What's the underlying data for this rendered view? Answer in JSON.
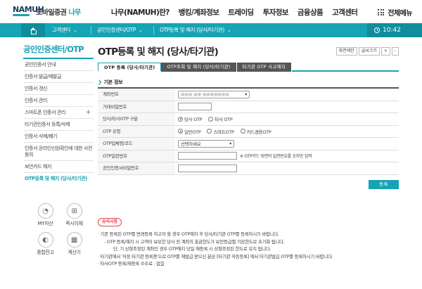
{
  "header": {
    "logo_mark": "NAMUH",
    "logo_title": "모바일증권",
    "logo_tag": "나무",
    "gnb": [
      "나무(NAMUH)란?",
      "뱅킹/계좌정보",
      "트레이딩",
      "투자정보",
      "금융상품",
      "고객센터"
    ],
    "all_menu": "전체메뉴"
  },
  "breadcrumb": {
    "items": [
      "고객센터",
      "공인인증센터/OTP",
      "OTP등록 및 해지 (당사/타기관)"
    ],
    "time": "10:42"
  },
  "sidebar": {
    "title": "공인인증센터/OTP",
    "items": [
      {
        "label": "공인인증서 안내",
        "plus": ""
      },
      {
        "label": "인증서 발급/재발급",
        "plus": ""
      },
      {
        "label": "인증서 갱신",
        "plus": ""
      },
      {
        "label": "인증서 관리",
        "plus": ""
      },
      {
        "label": "스마트폰 인증서 관리",
        "plus": "+"
      },
      {
        "label": "타기관인증서 등록/삭제",
        "plus": ""
      },
      {
        "label": "인증서 삭제/폐기",
        "plus": ""
      },
      {
        "label": "인증서 온라인신원확인에 대한 사전동의",
        "plus": ""
      },
      {
        "label": "보안카드 해지",
        "plus": ""
      },
      {
        "label": "OTP등록 및 해지 (당사/타기관)",
        "plus": ""
      }
    ],
    "quick": [
      {
        "label": "MY자산",
        "icon": "pie-chart-icon",
        "glyph": "◔"
      },
      {
        "label": "즉시이체",
        "icon": "transfer-icon",
        "glyph": "⊞"
      },
      {
        "label": "종합잔고",
        "icon": "balance-icon",
        "glyph": "◐"
      },
      {
        "label": "계산기",
        "icon": "calculator-icon",
        "glyph": "▦"
      }
    ]
  },
  "main": {
    "title": "OTP등록 및 해지 (당사/타기관)",
    "top_buttons": [
      "화면제안",
      "글씨크기",
      "+",
      "-"
    ],
    "tabs": [
      "OTP 등록 (당사/타기관)",
      "OTP조회 및 해지 (당사/타기관)",
      "타기관 OTP 사고해지"
    ],
    "section_title": "기본 정보",
    "form": {
      "account_label": "계좌번호",
      "account_value": "●●●-●●-●●●●●●●",
      "password_label": "거래비밀번호",
      "type_label": "당사/타사OTP 구분",
      "type_options": [
        {
          "label": "당사 OTP",
          "checked": true
        },
        {
          "label": "타사 OTP",
          "checked": false
        }
      ],
      "otp_kind_label": "OTP 유형",
      "otp_kind_options": [
        {
          "label": "일반OTP",
          "checked": true
        },
        {
          "label": "스마트OTP",
          "checked": false
        },
        {
          "label": "카드겸용OTP",
          "checked": false
        }
      ],
      "company_label": "OTP업체명/코드",
      "company_placeholder": "선택하세요",
      "serial_label": "OTP일련번호",
      "serial_note": "※ OTP카드 뒷면의 일련번호를 숫자만 입력",
      "cert_pw_label": "공인인증서비밀번호"
    },
    "submit": "등록"
  },
  "notice": {
    "badge": "유의사항",
    "lines": [
      "· 기존 등록된 OTP를 변경등록 하고자 할 경우 OTP해지 후 당사/타기관 OTP를 등록하시기 바랍니다.",
      "- OTP 등록/해지 시 고객이 보유한 당사 전 계좌의 출금한도가 보안등급별 기본한도로 초기화 됩니다.",
      "단, 기 상향조정된 계좌인 경우 OTP해지 당일 해등록 시 상향조정된 한도로 유지 됩니다.",
      "· 타기관에서 '자동 타기관 등록중'으로 OTP를 재발급 받으신 분은 [타기관 자동등록] 에서 타기관발급 OTP를 등록하시기 바랍니다.",
      "· 타사OTP 등록/재등록 수수료 : 없음"
    ]
  },
  "colors": {
    "accent": "#16a3b4",
    "accent_dark": "#0f8d9c",
    "notice_red": "#e0454e"
  }
}
